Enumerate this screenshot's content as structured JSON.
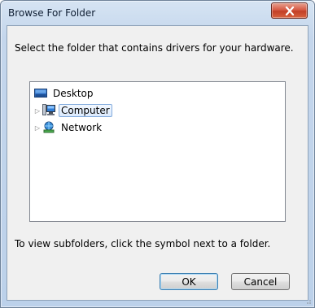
{
  "window": {
    "title": "Browse For Folder",
    "close_icon": "close-icon"
  },
  "dialog": {
    "instruction": "Select the folder that contains drivers for your hardware.",
    "hint": "To view subfolders, click the symbol next to a folder."
  },
  "tree": {
    "nodes": [
      {
        "label": "Desktop",
        "icon": "desktop-icon",
        "expandable": false,
        "selected": false
      },
      {
        "label": "Computer",
        "icon": "computer-icon",
        "expandable": true,
        "selected": true
      },
      {
        "label": "Network",
        "icon": "network-icon",
        "expandable": true,
        "selected": false
      }
    ]
  },
  "buttons": {
    "ok": "OK",
    "cancel": "Cancel"
  },
  "colors": {
    "accent": "#3c7fb1",
    "close_red": "#c23f26",
    "selection_border": "#84acdd"
  }
}
